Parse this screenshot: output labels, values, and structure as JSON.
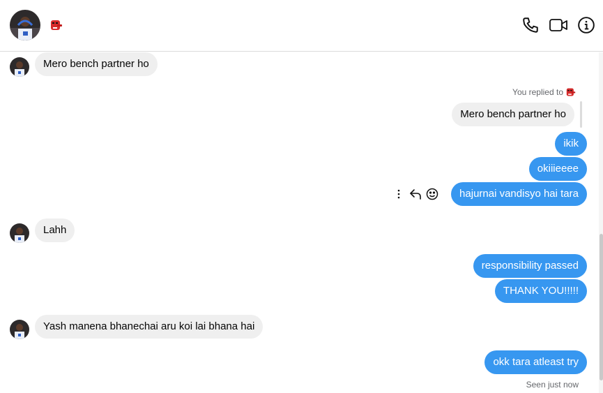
{
  "header": {
    "avatar_icon": "profile-avatar",
    "emoji_icon": "tengu-mask-emoji",
    "actions": [
      "phone-icon",
      "video-icon",
      "info-icon"
    ]
  },
  "messages": {
    "m1": "Mero bench partner ho",
    "reply_note": "You replied to",
    "m2_quoted": "Mero bench partner ho",
    "m3": "ikik",
    "m4": "okiiieeee",
    "m5": "hajurnai vandisyo hai tara",
    "m6": "Lahh",
    "m7": "responsibility passed",
    "m8": "THANK YOU!!!!!",
    "m9": "Yash manena bhanechai aru koi lai bhana hai",
    "m10": "okk tara atleast try"
  },
  "status": {
    "seen": "Seen just now"
  },
  "colors": {
    "outgoing": "#3797f0",
    "incoming": "#efefef",
    "divider": "#dbdbdb"
  }
}
